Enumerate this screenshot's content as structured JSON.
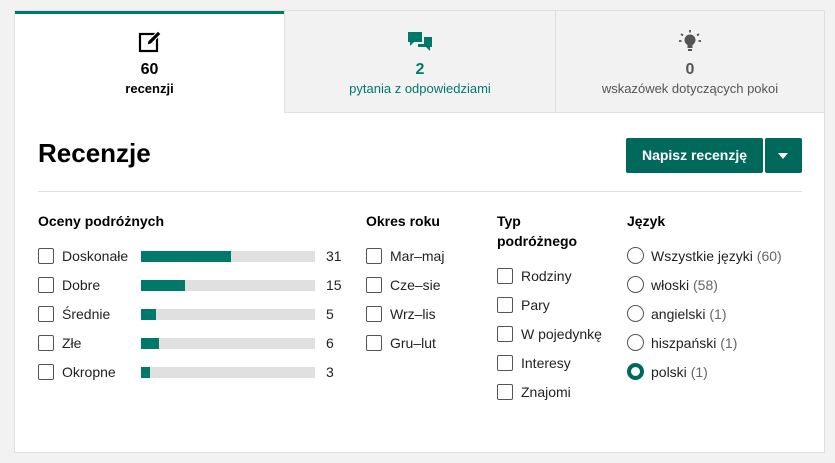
{
  "tabs": [
    {
      "count": "60",
      "label": "recenzji",
      "icon": "edit-icon"
    },
    {
      "count": "2",
      "label": "pytania z odpowiedziami",
      "icon": "chat-icon"
    },
    {
      "count": "0",
      "label": "wskazówek dotyczących pokoi",
      "icon": "lightbulb-icon"
    }
  ],
  "reviews": {
    "title": "Recenzje",
    "write_button": "Napisz recenzję"
  },
  "ratings": {
    "heading": "Oceny podróżnych",
    "max": 31,
    "items": [
      {
        "label": "Doskonałe",
        "count": 31
      },
      {
        "label": "Dobre",
        "count": 15
      },
      {
        "label": "Średnie",
        "count": 5
      },
      {
        "label": "Złe",
        "count": 6
      },
      {
        "label": "Okropne",
        "count": 3
      }
    ]
  },
  "season": {
    "heading": "Okres roku",
    "items": [
      "Mar–maj",
      "Cze–sie",
      "Wrz–lis",
      "Gru–lut"
    ]
  },
  "traveler_type": {
    "heading_line1": "Typ",
    "heading_line2": "podróżnego",
    "items": [
      "Rodziny",
      "Pary",
      "W pojedynkę",
      "Interesy",
      "Znajomi"
    ]
  },
  "language": {
    "heading": "Język",
    "selected": "polski",
    "items": [
      {
        "label": "Wszystkie języki",
        "count": "(60)"
      },
      {
        "label": "włoski",
        "count": "(58)"
      },
      {
        "label": "angielski",
        "count": "(1)"
      },
      {
        "label": "hiszpański",
        "count": "(1)"
      },
      {
        "label": "polski",
        "count": "(1)"
      }
    ]
  },
  "colors": {
    "accent": "#00796b",
    "button": "#00695c"
  }
}
